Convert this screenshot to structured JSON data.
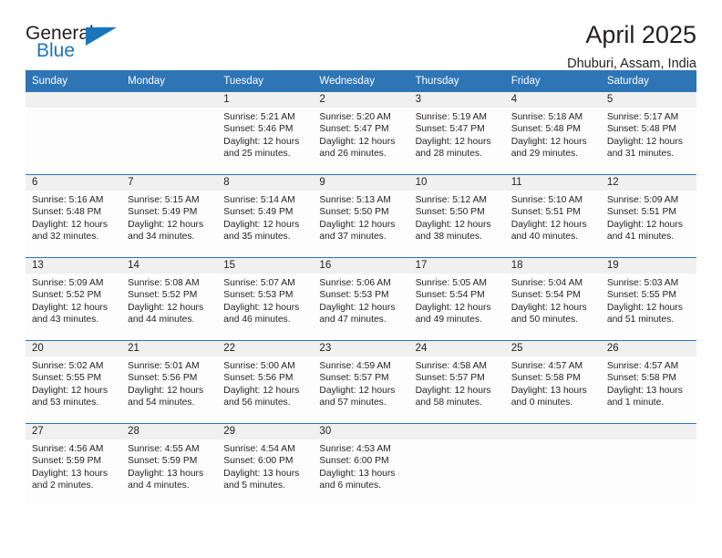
{
  "brand": {
    "name_dark": "General",
    "name_blue": "Blue",
    "logo_icon": "triangle-logo-icon",
    "accent_color": "#1b75bb"
  },
  "header": {
    "title": "April 2025",
    "location": "Dhuburi, Assam, India"
  },
  "calendar": {
    "header_bg": "#2e75b6",
    "date_band_bg": "#f0f0f0",
    "weekdays": [
      "Sunday",
      "Monday",
      "Tuesday",
      "Wednesday",
      "Thursday",
      "Friday",
      "Saturday"
    ],
    "weeks": [
      [
        {
          "date": "",
          "lines": []
        },
        {
          "date": "",
          "lines": []
        },
        {
          "date": "1",
          "lines": [
            "Sunrise: 5:21 AM",
            "Sunset: 5:46 PM",
            "Daylight: 12 hours",
            "and 25 minutes."
          ]
        },
        {
          "date": "2",
          "lines": [
            "Sunrise: 5:20 AM",
            "Sunset: 5:47 PM",
            "Daylight: 12 hours",
            "and 26 minutes."
          ]
        },
        {
          "date": "3",
          "lines": [
            "Sunrise: 5:19 AM",
            "Sunset: 5:47 PM",
            "Daylight: 12 hours",
            "and 28 minutes."
          ]
        },
        {
          "date": "4",
          "lines": [
            "Sunrise: 5:18 AM",
            "Sunset: 5:48 PM",
            "Daylight: 12 hours",
            "and 29 minutes."
          ]
        },
        {
          "date": "5",
          "lines": [
            "Sunrise: 5:17 AM",
            "Sunset: 5:48 PM",
            "Daylight: 12 hours",
            "and 31 minutes."
          ]
        }
      ],
      [
        {
          "date": "6",
          "lines": [
            "Sunrise: 5:16 AM",
            "Sunset: 5:48 PM",
            "Daylight: 12 hours",
            "and 32 minutes."
          ]
        },
        {
          "date": "7",
          "lines": [
            "Sunrise: 5:15 AM",
            "Sunset: 5:49 PM",
            "Daylight: 12 hours",
            "and 34 minutes."
          ]
        },
        {
          "date": "8",
          "lines": [
            "Sunrise: 5:14 AM",
            "Sunset: 5:49 PM",
            "Daylight: 12 hours",
            "and 35 minutes."
          ]
        },
        {
          "date": "9",
          "lines": [
            "Sunrise: 5:13 AM",
            "Sunset: 5:50 PM",
            "Daylight: 12 hours",
            "and 37 minutes."
          ]
        },
        {
          "date": "10",
          "lines": [
            "Sunrise: 5:12 AM",
            "Sunset: 5:50 PM",
            "Daylight: 12 hours",
            "and 38 minutes."
          ]
        },
        {
          "date": "11",
          "lines": [
            "Sunrise: 5:10 AM",
            "Sunset: 5:51 PM",
            "Daylight: 12 hours",
            "and 40 minutes."
          ]
        },
        {
          "date": "12",
          "lines": [
            "Sunrise: 5:09 AM",
            "Sunset: 5:51 PM",
            "Daylight: 12 hours",
            "and 41 minutes."
          ]
        }
      ],
      [
        {
          "date": "13",
          "lines": [
            "Sunrise: 5:09 AM",
            "Sunset: 5:52 PM",
            "Daylight: 12 hours",
            "and 43 minutes."
          ]
        },
        {
          "date": "14",
          "lines": [
            "Sunrise: 5:08 AM",
            "Sunset: 5:52 PM",
            "Daylight: 12 hours",
            "and 44 minutes."
          ]
        },
        {
          "date": "15",
          "lines": [
            "Sunrise: 5:07 AM",
            "Sunset: 5:53 PM",
            "Daylight: 12 hours",
            "and 46 minutes."
          ]
        },
        {
          "date": "16",
          "lines": [
            "Sunrise: 5:06 AM",
            "Sunset: 5:53 PM",
            "Daylight: 12 hours",
            "and 47 minutes."
          ]
        },
        {
          "date": "17",
          "lines": [
            "Sunrise: 5:05 AM",
            "Sunset: 5:54 PM",
            "Daylight: 12 hours",
            "and 49 minutes."
          ]
        },
        {
          "date": "18",
          "lines": [
            "Sunrise: 5:04 AM",
            "Sunset: 5:54 PM",
            "Daylight: 12 hours",
            "and 50 minutes."
          ]
        },
        {
          "date": "19",
          "lines": [
            "Sunrise: 5:03 AM",
            "Sunset: 5:55 PM",
            "Daylight: 12 hours",
            "and 51 minutes."
          ]
        }
      ],
      [
        {
          "date": "20",
          "lines": [
            "Sunrise: 5:02 AM",
            "Sunset: 5:55 PM",
            "Daylight: 12 hours",
            "and 53 minutes."
          ]
        },
        {
          "date": "21",
          "lines": [
            "Sunrise: 5:01 AM",
            "Sunset: 5:56 PM",
            "Daylight: 12 hours",
            "and 54 minutes."
          ]
        },
        {
          "date": "22",
          "lines": [
            "Sunrise: 5:00 AM",
            "Sunset: 5:56 PM",
            "Daylight: 12 hours",
            "and 56 minutes."
          ]
        },
        {
          "date": "23",
          "lines": [
            "Sunrise: 4:59 AM",
            "Sunset: 5:57 PM",
            "Daylight: 12 hours",
            "and 57 minutes."
          ]
        },
        {
          "date": "24",
          "lines": [
            "Sunrise: 4:58 AM",
            "Sunset: 5:57 PM",
            "Daylight: 12 hours",
            "and 58 minutes."
          ]
        },
        {
          "date": "25",
          "lines": [
            "Sunrise: 4:57 AM",
            "Sunset: 5:58 PM",
            "Daylight: 13 hours",
            "and 0 minutes."
          ]
        },
        {
          "date": "26",
          "lines": [
            "Sunrise: 4:57 AM",
            "Sunset: 5:58 PM",
            "Daylight: 13 hours",
            "and 1 minute."
          ]
        }
      ],
      [
        {
          "date": "27",
          "lines": [
            "Sunrise: 4:56 AM",
            "Sunset: 5:59 PM",
            "Daylight: 13 hours",
            "and 2 minutes."
          ]
        },
        {
          "date": "28",
          "lines": [
            "Sunrise: 4:55 AM",
            "Sunset: 5:59 PM",
            "Daylight: 13 hours",
            "and 4 minutes."
          ]
        },
        {
          "date": "29",
          "lines": [
            "Sunrise: 4:54 AM",
            "Sunset: 6:00 PM",
            "Daylight: 13 hours",
            "and 5 minutes."
          ]
        },
        {
          "date": "30",
          "lines": [
            "Sunrise: 4:53 AM",
            "Sunset: 6:00 PM",
            "Daylight: 13 hours",
            "and 6 minutes."
          ]
        },
        {
          "date": "",
          "lines": []
        },
        {
          "date": "",
          "lines": []
        },
        {
          "date": "",
          "lines": []
        }
      ]
    ]
  }
}
